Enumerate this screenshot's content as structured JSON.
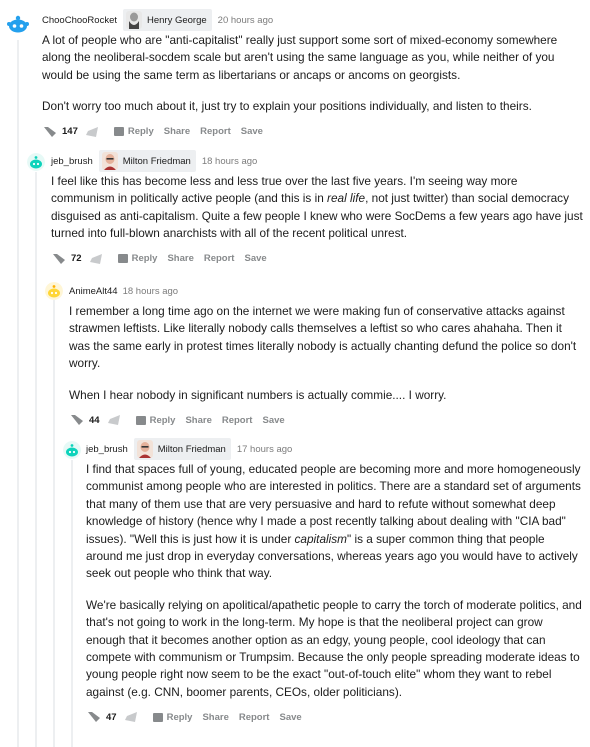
{
  "comments": [
    {
      "user": "ChooChooRocket",
      "flair": "Henry George",
      "time": "20 hours ago",
      "paragraphs": [
        "A lot of people who are \"anti-capitalist\" really just support some sort of mixed-economy somewhere along the neoliberal-socdem scale but aren't using the same language as you, while neither of you would be using the same term as libertarians or ancaps or ancoms on georgists.",
        "Don't worry too much about it, just try to explain your positions individually, and listen to theirs."
      ],
      "score": "147",
      "actions": [
        "Reply",
        "Share",
        "Report",
        "Save"
      ]
    },
    {
      "user": "jeb_brush",
      "flair": "Milton Friedman",
      "time": "18 hours ago",
      "p1_a": "I feel like this has become less and less true over the last five years. I'm seeing way more communism in politically active people (and this is in ",
      "p1_em": "real life",
      "p1_b": ", not just twitter) than social democracy disguised as anti-capitalism. Quite a few people I knew who were SocDems a few years ago have just turned into full-blown anarchists with all of the recent political unrest.",
      "score": "72",
      "actions": [
        "Reply",
        "Share",
        "Report",
        "Save"
      ]
    },
    {
      "user": "AnimeAlt44",
      "time": "18 hours ago",
      "paragraphs": [
        "I remember a long time ago on the internet we were making fun of conservative attacks against strawmen leftists. Like literally nobody calls themselves a leftist so who cares ahahaha. Then it was the same early in protest times literally nobody is actually chanting defund the police so don't worry.",
        "When I hear nobody in significant numbers is actually commie.... I worry."
      ],
      "score": "44",
      "actions": [
        "Reply",
        "Share",
        "Report",
        "Save"
      ]
    },
    {
      "user": "jeb_brush",
      "flair": "Milton Friedman",
      "time": "17 hours ago",
      "p1_a": "I find that spaces full of young, educated people are becoming more and more homogeneously communist among people who are interested in politics. There are a standard set of arguments that many of them use that are very persuasive and hard to refute without somewhat deep knowledge of history (hence why I made a post recently talking about dealing with \"CIA bad\" issues). \"Well this is just how it is under ",
      "p1_em": "capitalism",
      "p1_b": "\" is a super common thing that people around me just drop in everyday conversations, whereas years ago you would have to actively seek out people who think that way.",
      "p2": "We're basically relying on apolitical/apathetic people to carry the torch of moderate politics, and that's not going to work in the long-term. My hope is that the neoliberal project can grow enough that it becomes another option as an edgy, young people, cool ideology that can compete with communism or Trumpsim. Because the only people spreading moderate ideas to young people right now seem to be the exact \"out-of-touch elite\" whom they want to rebel against (e.g. CNN, boomer parents, CEOs, older politicians).",
      "score": "47",
      "actions": [
        "Reply",
        "Share",
        "Report",
        "Save"
      ]
    }
  ],
  "colors": {
    "meta": "#7c7c7c",
    "line": "#edeff1",
    "action": "#878a8c",
    "snoo_blue": "#0dd3bb"
  }
}
